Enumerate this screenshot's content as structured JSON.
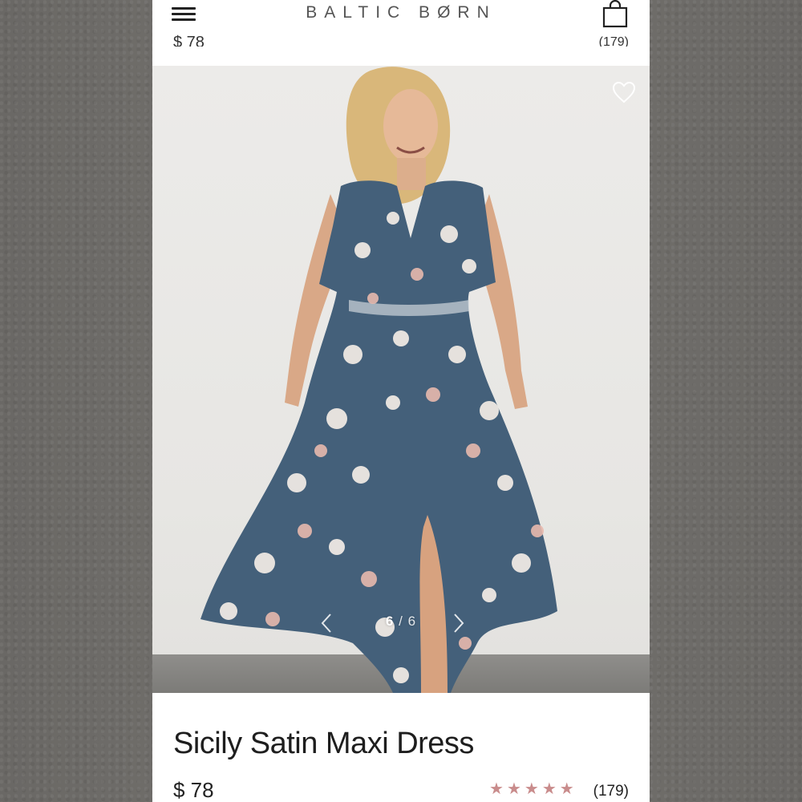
{
  "header": {
    "brand": "BALTIC BØRN",
    "cut_price": "$ 78",
    "cut_reviews": "(179)"
  },
  "gallery": {
    "current": "6",
    "separator": "/",
    "total": "6"
  },
  "product": {
    "title": "Sicily Satin Maxi Dress",
    "price": "$ 78",
    "rating": 5,
    "reviews": "(179)"
  },
  "icons": {
    "menu": "hamburger-menu-icon",
    "bag": "shopping-bag-icon",
    "favorite": "heart-outline-icon",
    "prev": "chevron-left-icon",
    "next": "chevron-right-icon",
    "star": "star-icon"
  },
  "colors": {
    "star": "#c98c8c",
    "dress": "#44607a"
  }
}
